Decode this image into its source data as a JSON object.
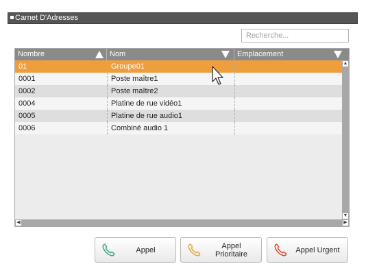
{
  "window": {
    "title": "Carnet D'Adresses"
  },
  "search": {
    "placeholder": "Recherche..."
  },
  "table": {
    "headers": [
      "Nombre",
      "Nom",
      "Emplacement"
    ],
    "rows": [
      {
        "num": "01",
        "nom": "Groupe01",
        "emplacement": ""
      },
      {
        "num": "0001",
        "nom": "Poste maître1",
        "emplacement": ""
      },
      {
        "num": "0002",
        "nom": "Poste maître2",
        "emplacement": ""
      },
      {
        "num": "0004",
        "nom": "Platine de rue vidéo1",
        "emplacement": ""
      },
      {
        "num": "0005",
        "nom": "Platine de rue audio1",
        "emplacement": ""
      },
      {
        "num": "0006",
        "nom": "Combiné audio 1",
        "emplacement": ""
      }
    ],
    "selected_row": 0
  },
  "buttons": {
    "call": {
      "label": "Appel",
      "icon": "phone-icon",
      "color": "#3aa37a"
    },
    "priority_call": {
      "label": "Appel Prioritaire",
      "icon": "phone-icon",
      "color": "#e8a53a"
    },
    "urgent_call": {
      "label": "Appel Urgent",
      "icon": "phone-icon",
      "color": "#d9472b"
    }
  },
  "colors": {
    "selected_row": "#ef9e3e",
    "title_bar": "#555555",
    "header": "#8a8a8a"
  }
}
